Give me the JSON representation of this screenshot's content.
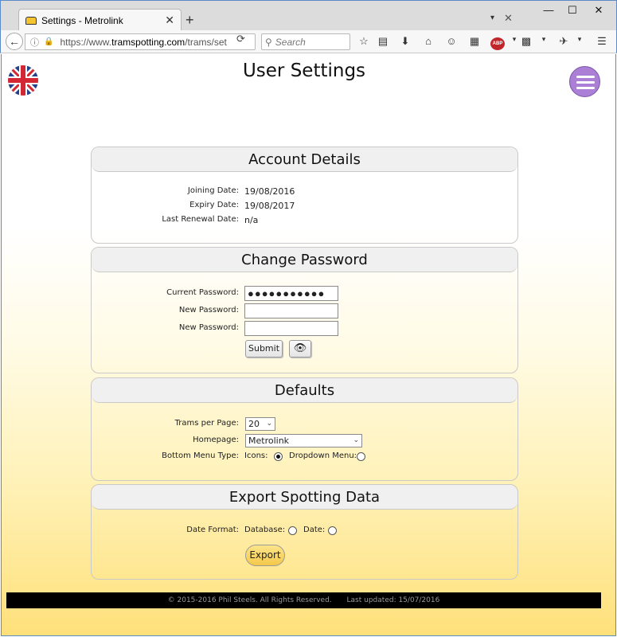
{
  "browser": {
    "tab_title": "Settings - Metrolink",
    "new_tab": "+",
    "url_prefix": "https://www.",
    "url_domain": "tramspotting.com",
    "url_path": "/trams/sett",
    "search_placeholder": "Search",
    "abp_label": "ABP"
  },
  "page": {
    "title": "User Settings"
  },
  "account": {
    "heading": "Account Details",
    "joining_label": "Joining Date:",
    "joining_value": "19/08/2016",
    "expiry_label": "Expiry Date:",
    "expiry_value": "19/08/2017",
    "renewal_label": "Last Renewal Date:",
    "renewal_value": "n/a"
  },
  "password": {
    "heading": "Change Password",
    "current_label": "Current Password:",
    "current_value": "●●●●●●●●●●●",
    "new_label": "New Password:",
    "new_label2": "New Password:",
    "submit_label": "Submit"
  },
  "defaults": {
    "heading": "Defaults",
    "trams_label": "Trams per Page:",
    "trams_value": "20",
    "homepage_label": "Homepage:",
    "homepage_value": "Metrolink",
    "menu_type_label": "Bottom Menu Type:",
    "icons_label": "Icons:",
    "dropdown_label": "Dropdown Menu:",
    "menu_type_selected": "Icons"
  },
  "export": {
    "heading": "Export Spotting Data",
    "date_format_label": "Date Format:",
    "database_label": "Database:",
    "date_label": "Date:",
    "export_label": "Export"
  },
  "footer": {
    "copyright": "© 2015-2016 Phil Steels. All Rights Reserved.",
    "updated": "Last updated: 15/07/2016"
  },
  "colors": {
    "menu_button": "#ab7fd6",
    "export_button": "#f4c84a",
    "footer_bg": "#000000"
  }
}
